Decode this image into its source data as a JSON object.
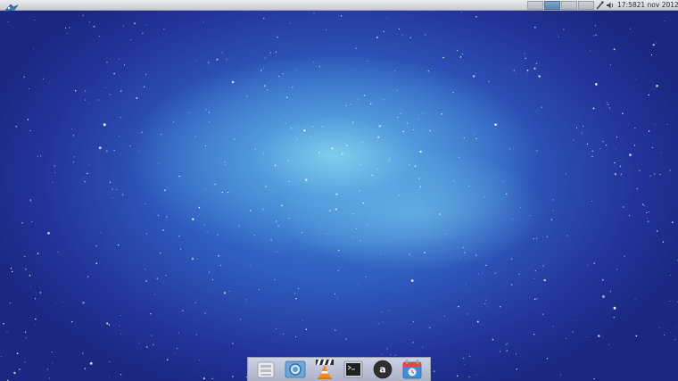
{
  "top_panel": {
    "menu_icon": "xfce-mouse-icon",
    "workspaces": [
      {
        "index": 1,
        "active": false
      },
      {
        "index": 2,
        "active": true
      },
      {
        "index": 3,
        "active": false
      },
      {
        "index": 4,
        "active": false
      }
    ],
    "tray_icons": [
      "network-icon",
      "volume-icon"
    ],
    "clock": {
      "time": "17:58",
      "date": "21 nov 2012"
    }
  },
  "dock": {
    "items": [
      {
        "name": "file-manager",
        "icon": "file-manager-icon"
      },
      {
        "name": "browser",
        "icon": "browser-icon"
      },
      {
        "name": "vlc",
        "icon": "vlc-icon"
      },
      {
        "name": "terminal",
        "icon": "terminal-icon"
      },
      {
        "name": "amazon",
        "icon": "amazon-icon"
      },
      {
        "name": "calendar-app",
        "icon": "calendar-icon"
      }
    ]
  },
  "colors": {
    "panel": "#d8dce1",
    "active_workspace": "#6a95c0",
    "wallpaper_center": "#7fcfee",
    "wallpaper_edge": "#1b2780"
  }
}
